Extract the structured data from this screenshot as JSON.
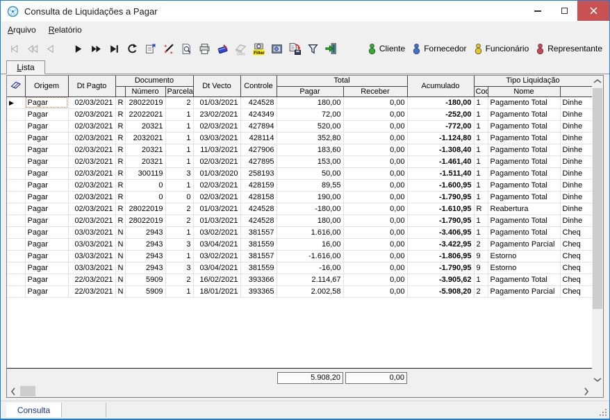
{
  "window": {
    "title": "Consulta de Liquidações a Pagar"
  },
  "menu": {
    "items": [
      {
        "label": "Arquivo"
      },
      {
        "label": "Relatório"
      }
    ]
  },
  "toolbar": {
    "goto_label": "Goto",
    "filter_label": "Filter",
    "legend": [
      {
        "label": "Cliente",
        "color": "#2fae2f"
      },
      {
        "label": "Fornecedor",
        "color": "#3f6fd1"
      },
      {
        "label": "Funcionário",
        "color": "#e6c619"
      },
      {
        "label": "Representante",
        "color": "#cc4455"
      }
    ]
  },
  "tabs": {
    "lista": "Lista"
  },
  "grid": {
    "headers": {
      "origem": "Origem",
      "dt_pagto": "Dt Pagto",
      "documento": "Documento",
      "numero": "Número",
      "parcela": "Parcela",
      "dt_vecto": "Dt Vecto",
      "controle": "Controle",
      "total": "Total",
      "pagar": "Pagar",
      "receber": "Receber",
      "acumulado": "Acumulado",
      "tipo_liquidacao": "Tipo Liquidação",
      "cod": "Cod",
      "nome": "Nome"
    },
    "current_row": 0,
    "rows": [
      {
        "origem": "Pagar",
        "dt_pagto": "02/03/2021",
        "esp": "R",
        "numero": "28022019",
        "parcela": "2",
        "dt_vecto": "01/03/2021",
        "controle": "424528",
        "pagar": "180,00",
        "receber": "0,00",
        "acumulado": "-180,00",
        "cod": "1",
        "nome": "Pagamento Total",
        "forma": "Dinhe"
      },
      {
        "origem": "Pagar",
        "dt_pagto": "02/03/2021",
        "esp": "R",
        "numero": "22022021",
        "parcela": "1",
        "dt_vecto": "23/02/2021",
        "controle": "424349",
        "pagar": "72,00",
        "receber": "0,00",
        "acumulado": "-252,00",
        "cod": "1",
        "nome": "Pagamento Total",
        "forma": "Dinhe"
      },
      {
        "origem": "Pagar",
        "dt_pagto": "02/03/2021",
        "esp": "R",
        "numero": "20321",
        "parcela": "1",
        "dt_vecto": "02/03/2021",
        "controle": "427894",
        "pagar": "520,00",
        "receber": "0,00",
        "acumulado": "-772,00",
        "cod": "1",
        "nome": "Pagamento Total",
        "forma": "Dinhe"
      },
      {
        "origem": "Pagar",
        "dt_pagto": "02/03/2021",
        "esp": "R",
        "numero": "2032021",
        "parcela": "1",
        "dt_vecto": "03/03/2021",
        "controle": "428114",
        "pagar": "352,80",
        "receber": "0,00",
        "acumulado": "-1.124,80",
        "cod": "1",
        "nome": "Pagamento Total",
        "forma": "Dinhe"
      },
      {
        "origem": "Pagar",
        "dt_pagto": "02/03/2021",
        "esp": "R",
        "numero": "20321",
        "parcela": "1",
        "dt_vecto": "11/03/2021",
        "controle": "427906",
        "pagar": "183,60",
        "receber": "0,00",
        "acumulado": "-1.308,40",
        "cod": "1",
        "nome": "Pagamento Total",
        "forma": "Dinhe"
      },
      {
        "origem": "Pagar",
        "dt_pagto": "02/03/2021",
        "esp": "R",
        "numero": "20321",
        "parcela": "1",
        "dt_vecto": "02/03/2021",
        "controle": "427895",
        "pagar": "153,00",
        "receber": "0,00",
        "acumulado": "-1.461,40",
        "cod": "1",
        "nome": "Pagamento Total",
        "forma": "Dinhe"
      },
      {
        "origem": "Pagar",
        "dt_pagto": "02/03/2021",
        "esp": "R",
        "numero": "300119",
        "parcela": "3",
        "dt_vecto": "01/03/2020",
        "controle": "258193",
        "pagar": "50,00",
        "receber": "0,00",
        "acumulado": "-1.511,40",
        "cod": "1",
        "nome": "Pagamento Total",
        "forma": "Dinhe"
      },
      {
        "origem": "Pagar",
        "dt_pagto": "02/03/2021",
        "esp": "R",
        "numero": "0",
        "parcela": "1",
        "dt_vecto": "02/03/2021",
        "controle": "428159",
        "pagar": "89,55",
        "receber": "0,00",
        "acumulado": "-1.600,95",
        "cod": "1",
        "nome": "Pagamento Total",
        "forma": "Dinhe"
      },
      {
        "origem": "Pagar",
        "dt_pagto": "02/03/2021",
        "esp": "R",
        "numero": "0",
        "parcela": "0",
        "dt_vecto": "02/03/2021",
        "controle": "428158",
        "pagar": "190,00",
        "receber": "0,00",
        "acumulado": "-1.790,95",
        "cod": "1",
        "nome": "Pagamento Total",
        "forma": "Dinhe"
      },
      {
        "origem": "Pagar",
        "dt_pagto": "02/03/2021",
        "esp": "R",
        "numero": "28022019",
        "parcela": "2",
        "dt_vecto": "01/03/2021",
        "controle": "424528",
        "pagar": "-180,00",
        "receber": "0,00",
        "acumulado": "-1.610,95",
        "cod": "R",
        "nome": "Reabertura",
        "forma": "Dinhe"
      },
      {
        "origem": "Pagar",
        "dt_pagto": "02/03/2021",
        "esp": "R",
        "numero": "28022019",
        "parcela": "2",
        "dt_vecto": "01/03/2021",
        "controle": "424528",
        "pagar": "180,00",
        "receber": "0,00",
        "acumulado": "-1.790,95",
        "cod": "1",
        "nome": "Pagamento Total",
        "forma": "Dinhe"
      },
      {
        "origem": "Pagar",
        "dt_pagto": "03/03/2021",
        "esp": "N",
        "numero": "2943",
        "parcela": "1",
        "dt_vecto": "03/02/2021",
        "controle": "381557",
        "pagar": "1.616,00",
        "receber": "0,00",
        "acumulado": "-3.406,95",
        "cod": "1",
        "nome": "Pagamento Total",
        "forma": "Cheq"
      },
      {
        "origem": "Pagar",
        "dt_pagto": "03/03/2021",
        "esp": "N",
        "numero": "2943",
        "parcela": "3",
        "dt_vecto": "03/04/2021",
        "controle": "381559",
        "pagar": "16,00",
        "receber": "0,00",
        "acumulado": "-3.422,95",
        "cod": "2",
        "nome": "Pagamento Parcial",
        "forma": "Cheq"
      },
      {
        "origem": "Pagar",
        "dt_pagto": "03/03/2021",
        "esp": "N",
        "numero": "2943",
        "parcela": "1",
        "dt_vecto": "03/02/2021",
        "controle": "381557",
        "pagar": "-1.616,00",
        "receber": "0,00",
        "acumulado": "-1.806,95",
        "cod": "9",
        "nome": "Estorno",
        "forma": "Cheq"
      },
      {
        "origem": "Pagar",
        "dt_pagto": "03/03/2021",
        "esp": "N",
        "numero": "2943",
        "parcela": "3",
        "dt_vecto": "03/04/2021",
        "controle": "381559",
        "pagar": "-16,00",
        "receber": "0,00",
        "acumulado": "-1.790,95",
        "cod": "9",
        "nome": "Estorno",
        "forma": "Cheq"
      },
      {
        "origem": "Pagar",
        "dt_pagto": "22/03/2021",
        "esp": "N",
        "numero": "5909",
        "parcela": "2",
        "dt_vecto": "16/02/2021",
        "controle": "393366",
        "pagar": "2.114,67",
        "receber": "0,00",
        "acumulado": "-3.905,62",
        "cod": "1",
        "nome": "Pagamento Total",
        "forma": "Cheq"
      },
      {
        "origem": "Pagar",
        "dt_pagto": "22/03/2021",
        "esp": "N",
        "numero": "5909",
        "parcela": "1",
        "dt_vecto": "18/01/2021",
        "controle": "393365",
        "pagar": "2.002,58",
        "receber": "0,00",
        "acumulado": "-5.908,20",
        "cod": "2",
        "nome": "Pagamento Parcial",
        "forma": "Cheq"
      }
    ]
  },
  "footer": {
    "total_pagar": "5.908,20",
    "total_receber": "0,00"
  },
  "statusbar": {
    "panel1": "Consulta"
  },
  "colors": {
    "highlight_green": "#c5e0c5",
    "close_red": "#ca5151"
  }
}
